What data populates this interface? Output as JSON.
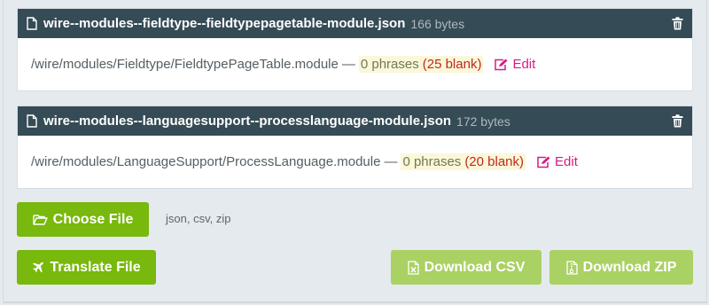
{
  "files": [
    {
      "name": "wire--modules--fieldtype--fieldtypepagetable-module.json",
      "size": "166 bytes",
      "path": "/wire/modules/Fieldtype/FieldtypePageTable.module",
      "dash": "—",
      "phrases": "0 phrases",
      "blank": "(25 blank)",
      "edit": "Edit"
    },
    {
      "name": "wire--modules--languagesupport--processlanguage-module.json",
      "size": "172 bytes",
      "path": "/wire/modules/LanguageSupport/ProcessLanguage.module",
      "dash": "—",
      "phrases": "0 phrases",
      "blank": "(20 blank)",
      "edit": "Edit"
    }
  ],
  "actions": {
    "choose_file": "Choose File",
    "accepted_types": "json, csv, zip",
    "translate_file": "Translate File",
    "download_csv": "Download CSV",
    "download_zip": "Download ZIP"
  },
  "colors": {
    "header_bg": "#354b55",
    "button_green": "#79b80c",
    "button_light_green": "#aad163",
    "edit_link": "#d61c83",
    "blank_count": "#c0281f"
  },
  "icons": [
    "file-icon",
    "trash-icon",
    "edit-icon",
    "folder-open-icon",
    "plane-icon",
    "csv-file-icon",
    "zip-file-icon"
  ]
}
